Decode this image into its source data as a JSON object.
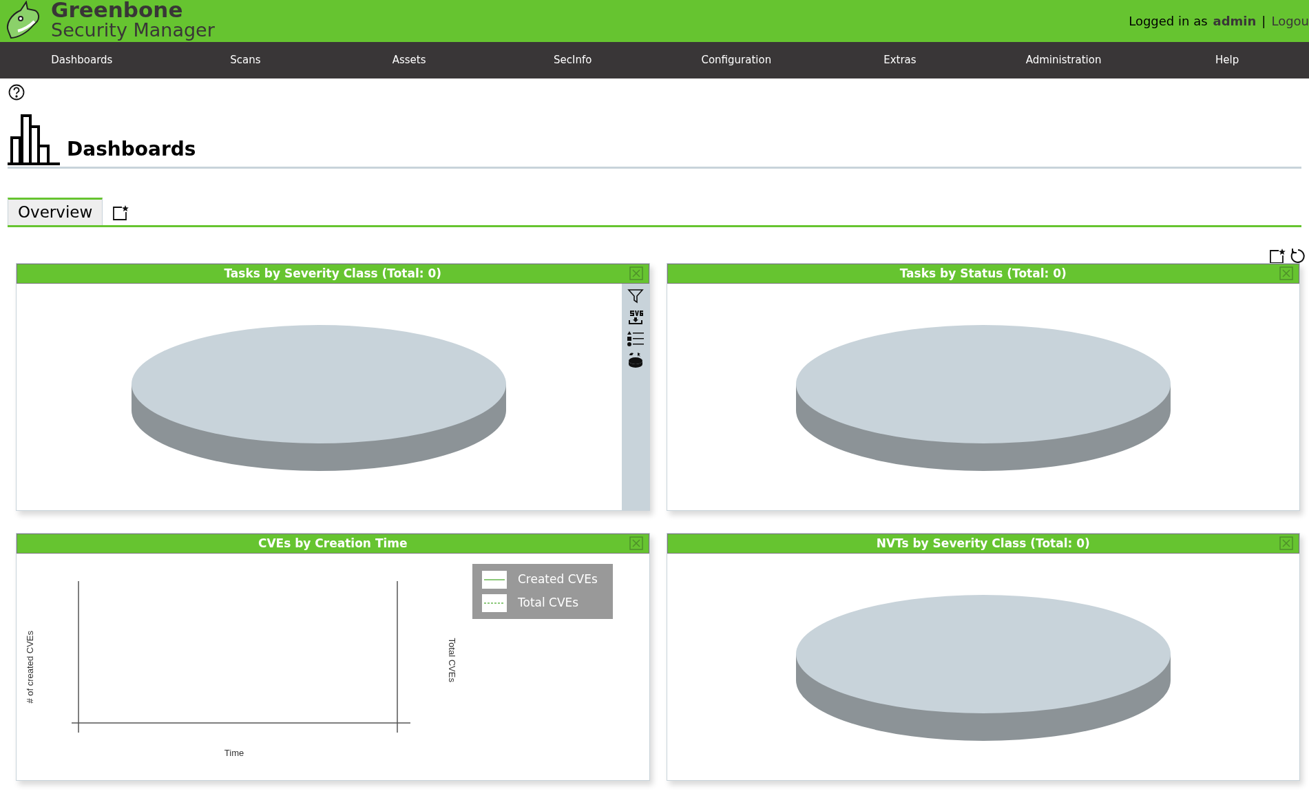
{
  "header": {
    "brand_name": "Greenbone",
    "brand_subtitle": "Security Manager",
    "logged_in_label": "Logged in as",
    "user": "admin",
    "separator": "|",
    "logout": "Logou"
  },
  "nav": [
    {
      "label": "Dashboards"
    },
    {
      "label": "Scans"
    },
    {
      "label": "Assets"
    },
    {
      "label": "SecInfo"
    },
    {
      "label": "Configuration"
    },
    {
      "label": "Extras"
    },
    {
      "label": "Administration"
    },
    {
      "label": "Help"
    }
  ],
  "page": {
    "title": "Dashboards"
  },
  "tabs": [
    {
      "label": "Overview",
      "selected": true
    }
  ],
  "panels": [
    {
      "title": "Tasks by Severity Class (Total: 0)",
      "kind": "pie",
      "toolbar_visible": true
    },
    {
      "title": "Tasks by Status (Total: 0)",
      "kind": "pie",
      "toolbar_visible": false
    },
    {
      "title": "CVEs by Creation Time",
      "kind": "line",
      "toolbar_visible": false,
      "y2label": "Total CVEs",
      "xlabel": "Time",
      "ylabel": "# of created CVEs",
      "legend": [
        {
          "name": "Created CVEs",
          "kind": "solid"
        },
        {
          "name": "Total CVEs",
          "kind": "dashed"
        }
      ]
    },
    {
      "title": "NVTs by Severity Class (Total: 0)",
      "kind": "pie",
      "toolbar_visible": false
    }
  ]
}
